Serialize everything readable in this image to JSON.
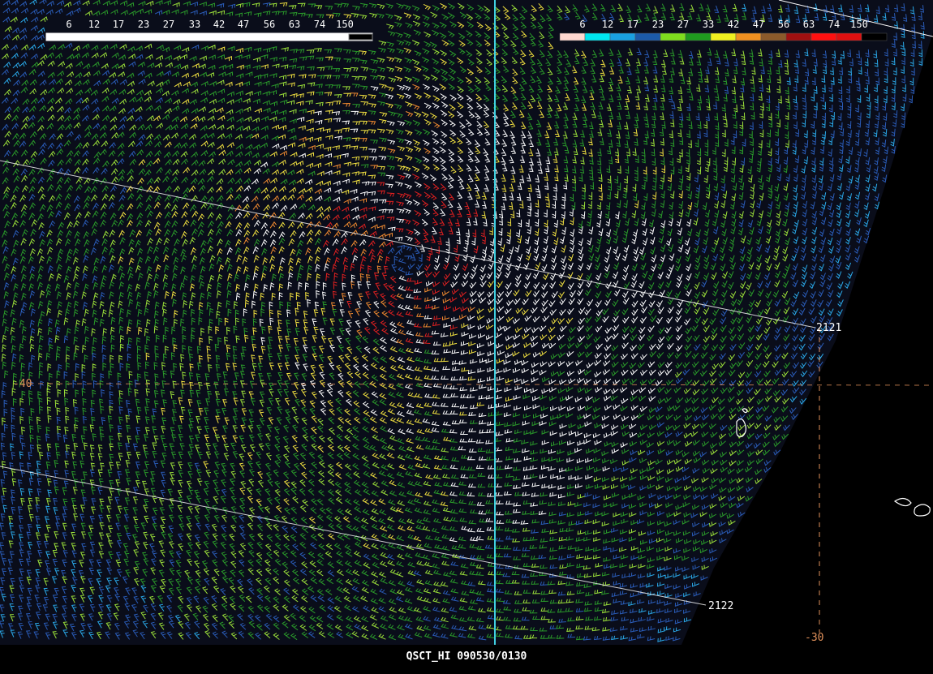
{
  "caption": "QSCT_HI 090530/0130",
  "left_scale": {
    "labels": [
      "6",
      "12",
      "17",
      "23",
      "27",
      "33",
      "42",
      "47",
      "56",
      "63",
      "74",
      "150"
    ]
  },
  "right_scale": {
    "labels": [
      "6",
      "12",
      "17",
      "23",
      "27",
      "33",
      "42",
      "47",
      "56",
      "63",
      "74",
      "150"
    ],
    "colors": [
      "#ffd8d0",
      "#00e5ef",
      "#1aa0e0",
      "#1c5aa8",
      "#7fdc1e",
      "#1f9a1f",
      "#f0f020",
      "#f09020",
      "#8b5a2b",
      "#a01010",
      "#ff1010",
      "#e01010",
      "#000000"
    ]
  },
  "grid_labels": {
    "lat_left": "-40",
    "lat_right": "-30",
    "swath_mid": "2121",
    "swath_bottom": "2122"
  },
  "wind_colors": {
    "blue": "#2a5cb8",
    "light_blue": "#2aa8e8",
    "lime": "#9be03a",
    "green": "#2a9a2a",
    "yellow": "#f0e040",
    "orange": "#f08a30",
    "red": "#e02020",
    "white": "#ffffff"
  }
}
